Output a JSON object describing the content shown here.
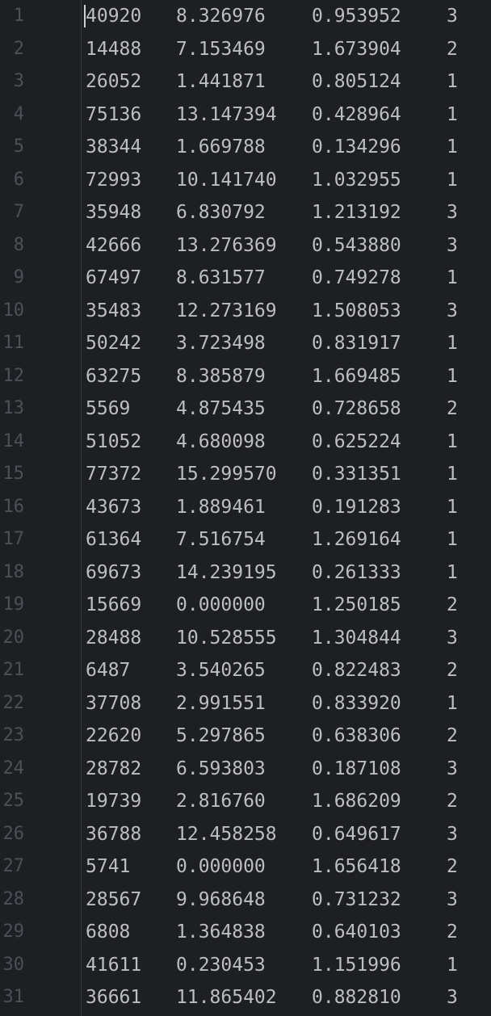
{
  "rows": [
    {
      "n": "1",
      "a": "40920",
      "b": "8.326976",
      "c": "0.953952",
      "d": "3"
    },
    {
      "n": "2",
      "a": "14488",
      "b": "7.153469",
      "c": "1.673904",
      "d": "2"
    },
    {
      "n": "3",
      "a": "26052",
      "b": "1.441871",
      "c": "0.805124",
      "d": "1"
    },
    {
      "n": "4",
      "a": "75136",
      "b": "13.147394",
      "c": "0.428964",
      "d": "1"
    },
    {
      "n": "5",
      "a": "38344",
      "b": "1.669788",
      "c": "0.134296",
      "d": "1"
    },
    {
      "n": "6",
      "a": "72993",
      "b": "10.141740",
      "c": "1.032955",
      "d": "1"
    },
    {
      "n": "7",
      "a": "35948",
      "b": "6.830792",
      "c": "1.213192",
      "d": "3"
    },
    {
      "n": "8",
      "a": "42666",
      "b": "13.276369",
      "c": "0.543880",
      "d": "3"
    },
    {
      "n": "9",
      "a": "67497",
      "b": "8.631577",
      "c": "0.749278",
      "d": "1"
    },
    {
      "n": "10",
      "a": "35483",
      "b": "12.273169",
      "c": "1.508053",
      "d": "3"
    },
    {
      "n": "11",
      "a": "50242",
      "b": "3.723498",
      "c": "0.831917",
      "d": "1"
    },
    {
      "n": "12",
      "a": "63275",
      "b": "8.385879",
      "c": "1.669485",
      "d": "1"
    },
    {
      "n": "13",
      "a": "5569",
      "b": "4.875435",
      "c": "0.728658",
      "d": "2"
    },
    {
      "n": "14",
      "a": "51052",
      "b": "4.680098",
      "c": "0.625224",
      "d": "1"
    },
    {
      "n": "15",
      "a": "77372",
      "b": "15.299570",
      "c": "0.331351",
      "d": "1"
    },
    {
      "n": "16",
      "a": "43673",
      "b": "1.889461",
      "c": "0.191283",
      "d": "1"
    },
    {
      "n": "17",
      "a": "61364",
      "b": "7.516754",
      "c": "1.269164",
      "d": "1"
    },
    {
      "n": "18",
      "a": "69673",
      "b": "14.239195",
      "c": "0.261333",
      "d": "1"
    },
    {
      "n": "19",
      "a": "15669",
      "b": "0.000000",
      "c": "1.250185",
      "d": "2"
    },
    {
      "n": "20",
      "a": "28488",
      "b": "10.528555",
      "c": "1.304844",
      "d": "3"
    },
    {
      "n": "21",
      "a": "6487",
      "b": "3.540265",
      "c": "0.822483",
      "d": "2"
    },
    {
      "n": "22",
      "a": "37708",
      "b": "2.991551",
      "c": "0.833920",
      "d": "1"
    },
    {
      "n": "23",
      "a": "22620",
      "b": "5.297865",
      "c": "0.638306",
      "d": "2"
    },
    {
      "n": "24",
      "a": "28782",
      "b": "6.593803",
      "c": "0.187108",
      "d": "3"
    },
    {
      "n": "25",
      "a": "19739",
      "b": "2.816760",
      "c": "1.686209",
      "d": "2"
    },
    {
      "n": "26",
      "a": "36788",
      "b": "12.458258",
      "c": "0.649617",
      "d": "3"
    },
    {
      "n": "27",
      "a": "5741",
      "b": "0.000000",
      "c": "1.656418",
      "d": "2"
    },
    {
      "n": "28",
      "a": "28567",
      "b": "9.968648",
      "c": "0.731232",
      "d": "3"
    },
    {
      "n": "29",
      "a": "6808",
      "b": "1.364838",
      "c": "0.640103",
      "d": "2"
    },
    {
      "n": "30",
      "a": "41611",
      "b": "0.230453",
      "c": "1.151996",
      "d": "1"
    },
    {
      "n": "31",
      "a": "36661",
      "b": "11.865402",
      "c": "0.882810",
      "d": "3"
    }
  ]
}
